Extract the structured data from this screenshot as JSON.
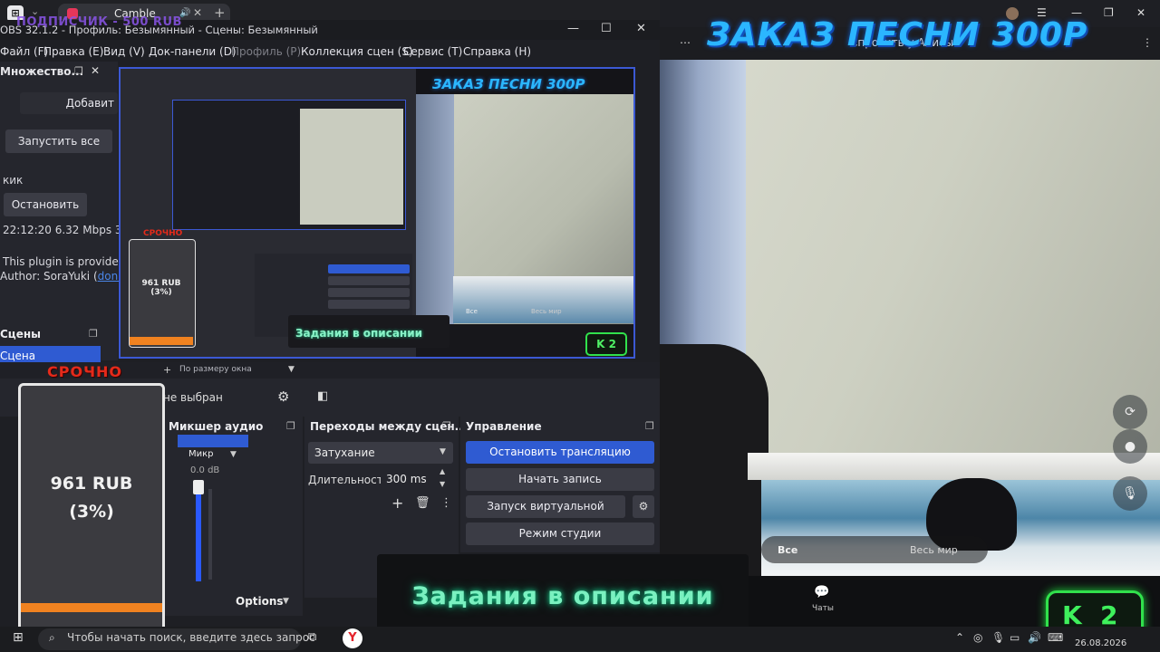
{
  "browser": {
    "tab_title": "Camble",
    "subscriber_overlay": "ПОДПИСЧИК - 500 RUB",
    "top_right_label": "Спросить у Алисы"
  },
  "obs": {
    "window_title": "OBS 32.1.2 - Профиль: Безымянный - Сцены: Безымянный",
    "menu": [
      "Файл (F)",
      "Правка (E)",
      "Вид (V)",
      "Док-панели (D)",
      "Профиль (P)",
      "Коллекция сцен (S)",
      "Сервис (T)",
      "Справка (H)"
    ],
    "left_dock": {
      "title": "Множество...",
      "add_label": "Добавит",
      "start_all": "Запустить все",
      "kick_label": "кик",
      "stop_label": "Остановить",
      "stats": "22:12:20  6.32 Mbps  3",
      "plugin_line1": "This plugin is provided f",
      "plugin_line2": "Author: SoraYuki (",
      "plugin_link": "donat"
    },
    "scenes": {
      "header": "Сцены",
      "item": "Сцена"
    },
    "zoom_label": "По размеру окна",
    "source_status": "не выбран",
    "mixer": {
      "header": "Микшер аудио",
      "device": "Микр",
      "db": "0.0 dB",
      "options": "Options"
    },
    "transitions": {
      "header": "Переходы между сцен...",
      "selected": "Затухание",
      "duration_label": "Длительность",
      "duration_value": "300 ms"
    },
    "control": {
      "header": "Управление",
      "stop_stream": "Остановить трансляцию",
      "start_record": "Начать запись",
      "virtual_cam": "Запуск виртуальной камеры",
      "studio_mode": "Режим студии"
    }
  },
  "stream": {
    "big_title": "ЗАКАЗ ПЕСНИ 300Р",
    "preview_title": "ЗАКАЗ ПЕСНИ 300Р",
    "urgent": "СРОЧНО",
    "donate_amount": "961 RUB",
    "donate_percent": "(3%)",
    "donate_progress": 0.03,
    "task_banner": "Задания в описании",
    "kick_letter": "K",
    "kick_count": "2",
    "chat_all": "Все",
    "chat_world": "Весь мир",
    "chats_label": "Чаты"
  },
  "taskbar": {
    "search_placeholder": "Чтобы начать поиск, введите здесь запрос",
    "date": "26.08.2026"
  },
  "colors": {
    "accent_blue": "#2f5bd2",
    "kick_green": "#31e14c",
    "title_cyan": "#2bb6ff",
    "urgent_red": "#e52a1a",
    "progress_orange": "#f08220"
  }
}
